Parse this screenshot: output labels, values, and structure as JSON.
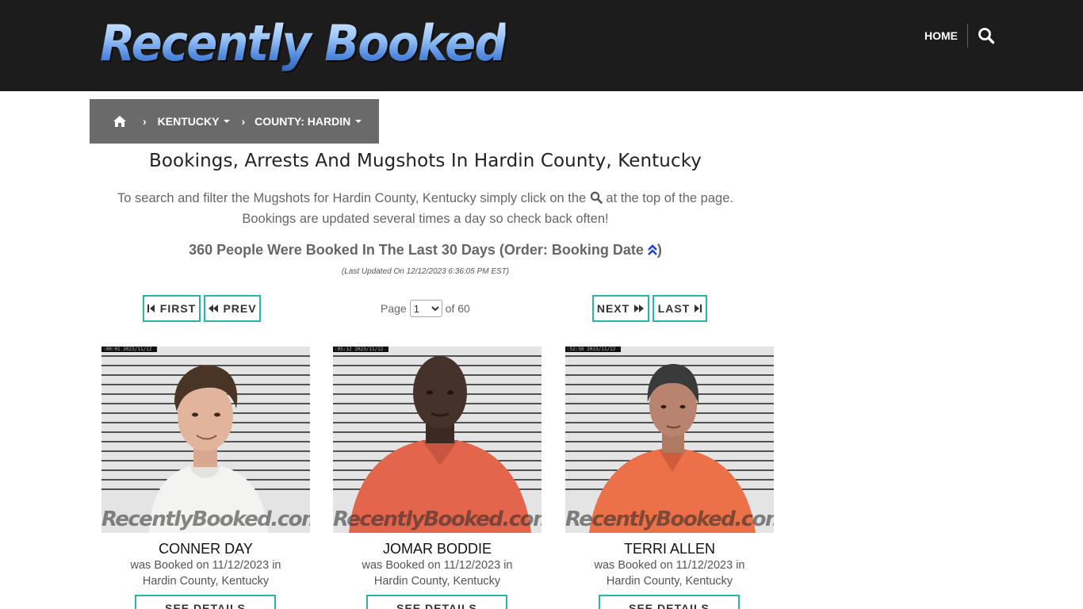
{
  "header": {
    "logo_text": "Recently Booked",
    "nav_home": "HOME",
    "search_icon": "search-icon"
  },
  "breadcrumb": {
    "home_icon": "home-icon",
    "state": "KENTUCKY",
    "county": "COUNTY: HARDIN"
  },
  "main": {
    "title": "Bookings, Arrests And Mugshots In Hardin County, Kentucky",
    "intro_part1": "To search and filter the Mugshots for Hardin County, Kentucky simply click on the",
    "intro_part2": "at the top of the page.",
    "intro_line2": "Bookings are updated several times a day so check back often!",
    "count_text": "360 People Were Booked In The Last 30 Days (Order: Booking Date",
    "count_close": ")",
    "last_updated": "(Last Updated On 12/12/2023 6:36:05 PM EST)"
  },
  "pager": {
    "first": "FIRST",
    "prev": "PREV",
    "next": "NEXT",
    "last": "LAST",
    "page_label": "Page",
    "selected_page": "1",
    "of_label": "of 60"
  },
  "colors": {
    "accent": "#26b5a8",
    "header_bg": "#1c1c1c",
    "breadcrumb_bg": "#6a6a6a",
    "order_icon": "#1a3fd6"
  },
  "bookings": [
    {
      "name": "CONNER DAY",
      "booked_line": "was Booked on 11/12/2023 in",
      "location": "Hardin County, Kentucky",
      "stamp": ":00:01  2023/11/12",
      "watermark": "RecentlyBooked.com",
      "details_label": "SEE DETAILS"
    },
    {
      "name": "JOMAR BODDIE",
      "booked_line": "was Booked on 11/12/2023 in",
      "location": "Hardin County, Kentucky",
      "stamp": ":05:12  2023/11/12",
      "watermark": "RecentlyBooked.com",
      "details_label": "SEE DETAILS"
    },
    {
      "name": "TERRI ALLEN",
      "booked_line": "was Booked on 11/12/2023 in",
      "location": "Hardin County, Kentucky",
      "stamp": ":52:50  2023/11/12",
      "watermark": "RecentlyBooked.com",
      "details_label": "SEE DETAILS"
    }
  ]
}
